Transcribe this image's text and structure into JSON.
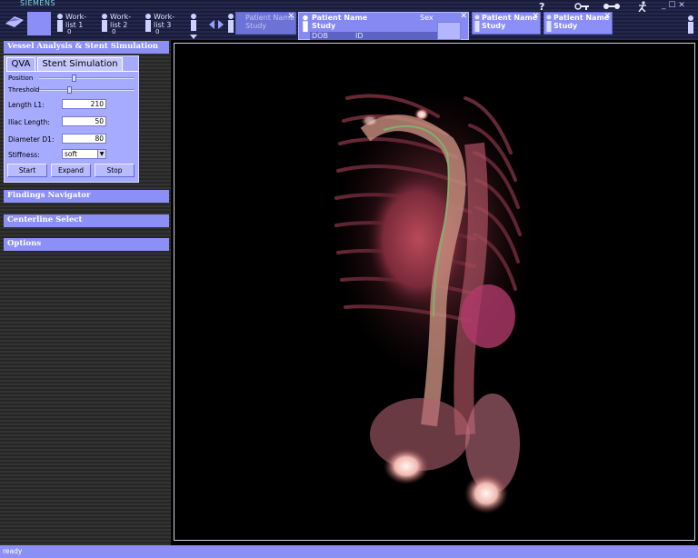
{
  "app": {
    "brand": "SIEMENS",
    "status": "ready"
  },
  "worklists": [
    {
      "label1": "Work-",
      "label2": "list 1",
      "count": "0"
    },
    {
      "label1": "Work-",
      "label2": "list 2",
      "count": "0"
    },
    {
      "label1": "Work-",
      "label2": "list 3",
      "count": "0"
    }
  ],
  "patient_tabs": {
    "ghost": {
      "name": "Patient Name",
      "study": "Study"
    },
    "active": {
      "name": "Patient Name",
      "study": "Study",
      "sex_label": "Sex",
      "dob_label": "DOB",
      "id_label": "ID"
    },
    "others": [
      {
        "name": "Patient Name",
        "study": "Study"
      },
      {
        "name": "Patient Name",
        "study": "Study"
      }
    ],
    "close_glyph": "✕"
  },
  "panel": {
    "vessel_header": "Vessel Analysis & Stent Simulation",
    "tabs": [
      "QVA",
      "Stent Simulation"
    ],
    "sliders": {
      "position_label": "Position",
      "threshold_label": "Threshold"
    },
    "fields": [
      {
        "label": "Length L1:",
        "value": "210"
      },
      {
        "label": "Iliac Length:",
        "value": "50"
      },
      {
        "label": "Diameter D1:",
        "value": "80"
      }
    ],
    "stiffness": {
      "label": "Stiffness:",
      "value": "soft"
    },
    "buttons": [
      "Start",
      "Expand",
      "Stop"
    ],
    "findings_header": "Findings Navigator",
    "centerline_header": "Centerline Select",
    "options_header": "Options"
  },
  "icons": {
    "help": "?",
    "windows": "_ ☐ ✕"
  },
  "colors": {
    "panel_accent": "#8c90f6",
    "tool_box": "#a7abff",
    "active_tab": "#8589f2"
  }
}
